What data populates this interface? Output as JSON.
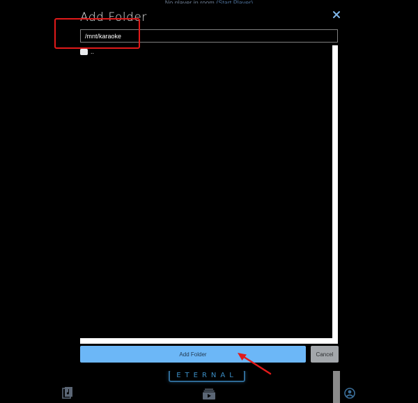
{
  "status_bar": {
    "text": "No player in room",
    "link": "(Start Player)"
  },
  "modal": {
    "title": "Add Folder",
    "close_icon": "close-icon",
    "path_value": "/mnt/karaoke",
    "items": [
      {
        "label": "..",
        "icon": "checkbox"
      }
    ],
    "primary_button": "Add Folder",
    "secondary_button": "Cancel"
  },
  "footer": {
    "logo_text": "ETERNAL",
    "icons": [
      "library-icon",
      "queue-icon",
      "account-icon"
    ]
  },
  "colors": {
    "accent": "#6cb7f7",
    "cancel": "#a3a7ab",
    "annotation": "#e21a1a",
    "background": "#000000"
  }
}
